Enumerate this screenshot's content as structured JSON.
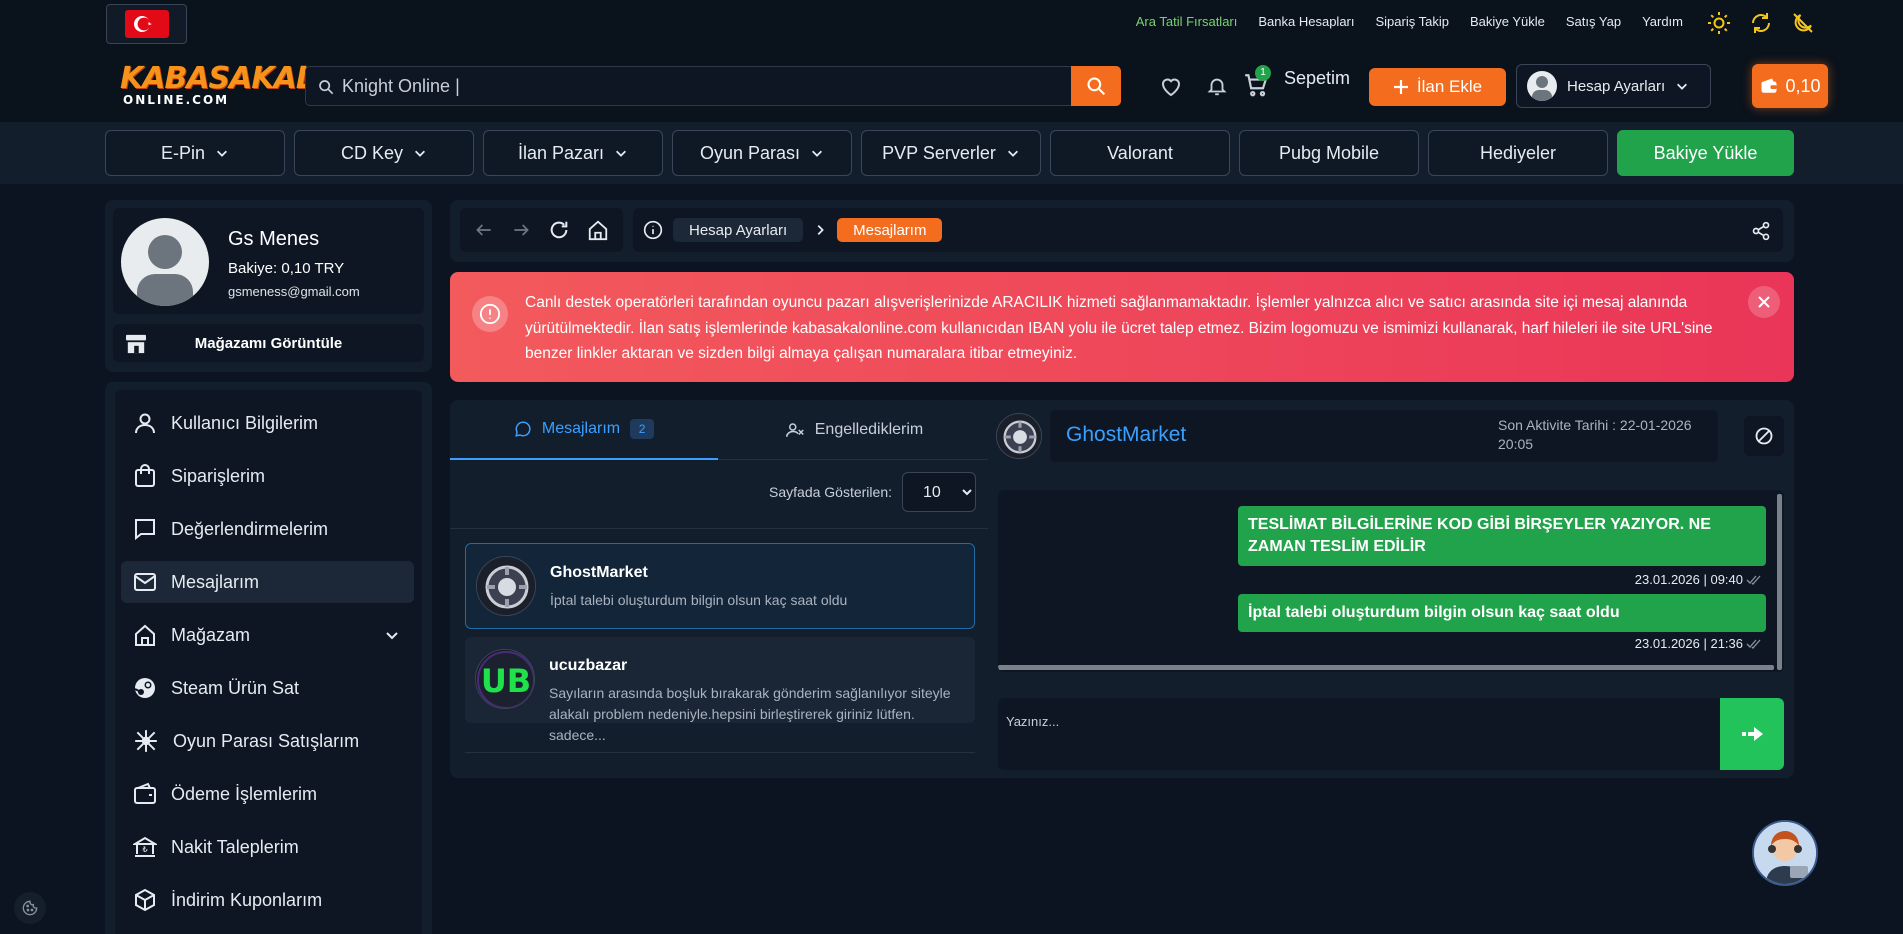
{
  "topbar": {
    "country_flag": "Turkey",
    "links": [
      "Ara Tatil Fırsatları",
      "Banka Hesapları",
      "Sipariş Takip",
      "Bakiye Yükle",
      "Satış Yap",
      "Yardım"
    ],
    "icons": [
      "sun-icon",
      "refresh-icon",
      "moon-off-icon"
    ]
  },
  "header": {
    "logo_line1": "KABASAKAL",
    "logo_line2": "ONLINE.COM",
    "search_value": "Knight Online |",
    "cart_count": "1",
    "cart_label": "Sepetim",
    "add_listing": "İlan Ekle",
    "account_settings": "Hesap Ayarları",
    "balance": "0,10"
  },
  "nav": {
    "items": [
      "E-Pin",
      "CD Key",
      "İlan Pazarı",
      "Oyun Parası",
      "PVP Serverler",
      "Valorant",
      "Pubg Mobile",
      "Hediyeler",
      "Bakiye Yükle"
    ]
  },
  "profile": {
    "name": "Gs Menes",
    "balance": "Bakiye: 0,10 TRY",
    "email": "gsmeness@gmail.com",
    "store_button": "Mağazamı Görüntüle"
  },
  "sidebar": {
    "items": [
      {
        "label": "Kullanıcı Bilgilerim",
        "icon": "user-icon"
      },
      {
        "label": "Siparişlerim",
        "icon": "shopping-bag-icon"
      },
      {
        "label": "Değerlendirmelerim",
        "icon": "comment-icon"
      },
      {
        "label": "Mesajlarım",
        "icon": "mail-icon"
      },
      {
        "label": "Mağazam",
        "icon": "home-icon"
      },
      {
        "label": "Steam Ürün Sat",
        "icon": "steam-icon"
      },
      {
        "label": "Oyun Parası Satışlarım",
        "icon": "coins-icon"
      },
      {
        "label": "Ödeme İşlemlerim",
        "icon": "wallet-icon"
      },
      {
        "label": "Nakit Taleplerim",
        "icon": "bank-icon"
      },
      {
        "label": "İndirim Kuponlarım",
        "icon": "box-icon"
      }
    ]
  },
  "breadcrumb": {
    "items": [
      "Hesap Ayarları",
      "Mesajlarım"
    ]
  },
  "alert": {
    "text": "Canlı destek operatörleri tarafından oyuncu pazarı alışverişlerinizde ARACILIK hizmeti sağlanmamaktadır. İşlemler yalnızca alıcı ve satıcı arasında site içi mesaj alanında yürütülmektedir. İlan satış işlemlerinde kabasakalonline.com kullanıcıdan IBAN yolu ile ücret talep etmez. Bizim logomuzu ve ismimizi kullanarak, harf hileleri ile site URL'sine benzer linkler aktaran ve sizden bilgi almaya çalışan numaralara itibar etmeyiniz."
  },
  "messages": {
    "tab_messages": "Mesajlarım",
    "tab_messages_count": "2",
    "tab_blocked": "Engellediklerim",
    "page_size_label": "Sayfada Gösterilen:",
    "page_size_value": "10",
    "conversations": [
      {
        "name": "GhostMarket",
        "preview": "İptal talebi oluşturdum bilgin olsun kaç saat oldu"
      },
      {
        "name": "ucuzbazar",
        "preview": "Sayıların arasında boşluk bırakarak gönderim sağlanılıyor siteyle alakalı problem nedeniyle.hepsini birleştirerek giriniz lütfen. sadece..."
      }
    ]
  },
  "chat": {
    "name": "GhostMarket",
    "last_activity": "Son Aktivite Tarihi : 22-01-2026 20:05",
    "messages": [
      {
        "text": "TESLİMAT BİLGİLERİNE KOD GİBİ BİRŞEYLER YAZIYOR. NE ZAMAN TESLİM EDİLİR",
        "time": "23.01.2026 | 09:40"
      },
      {
        "text": "İptal talebi oluşturdum bilgin olsun kaç saat oldu",
        "time": "23.01.2026 | 21:36"
      }
    ],
    "placeholder": "Yazınız..."
  },
  "colors": {
    "accent_orange": "#f46c1e",
    "accent_green": "#21a34b",
    "accent_blue": "#3aa0ff",
    "alert_red": "#ea3558"
  }
}
